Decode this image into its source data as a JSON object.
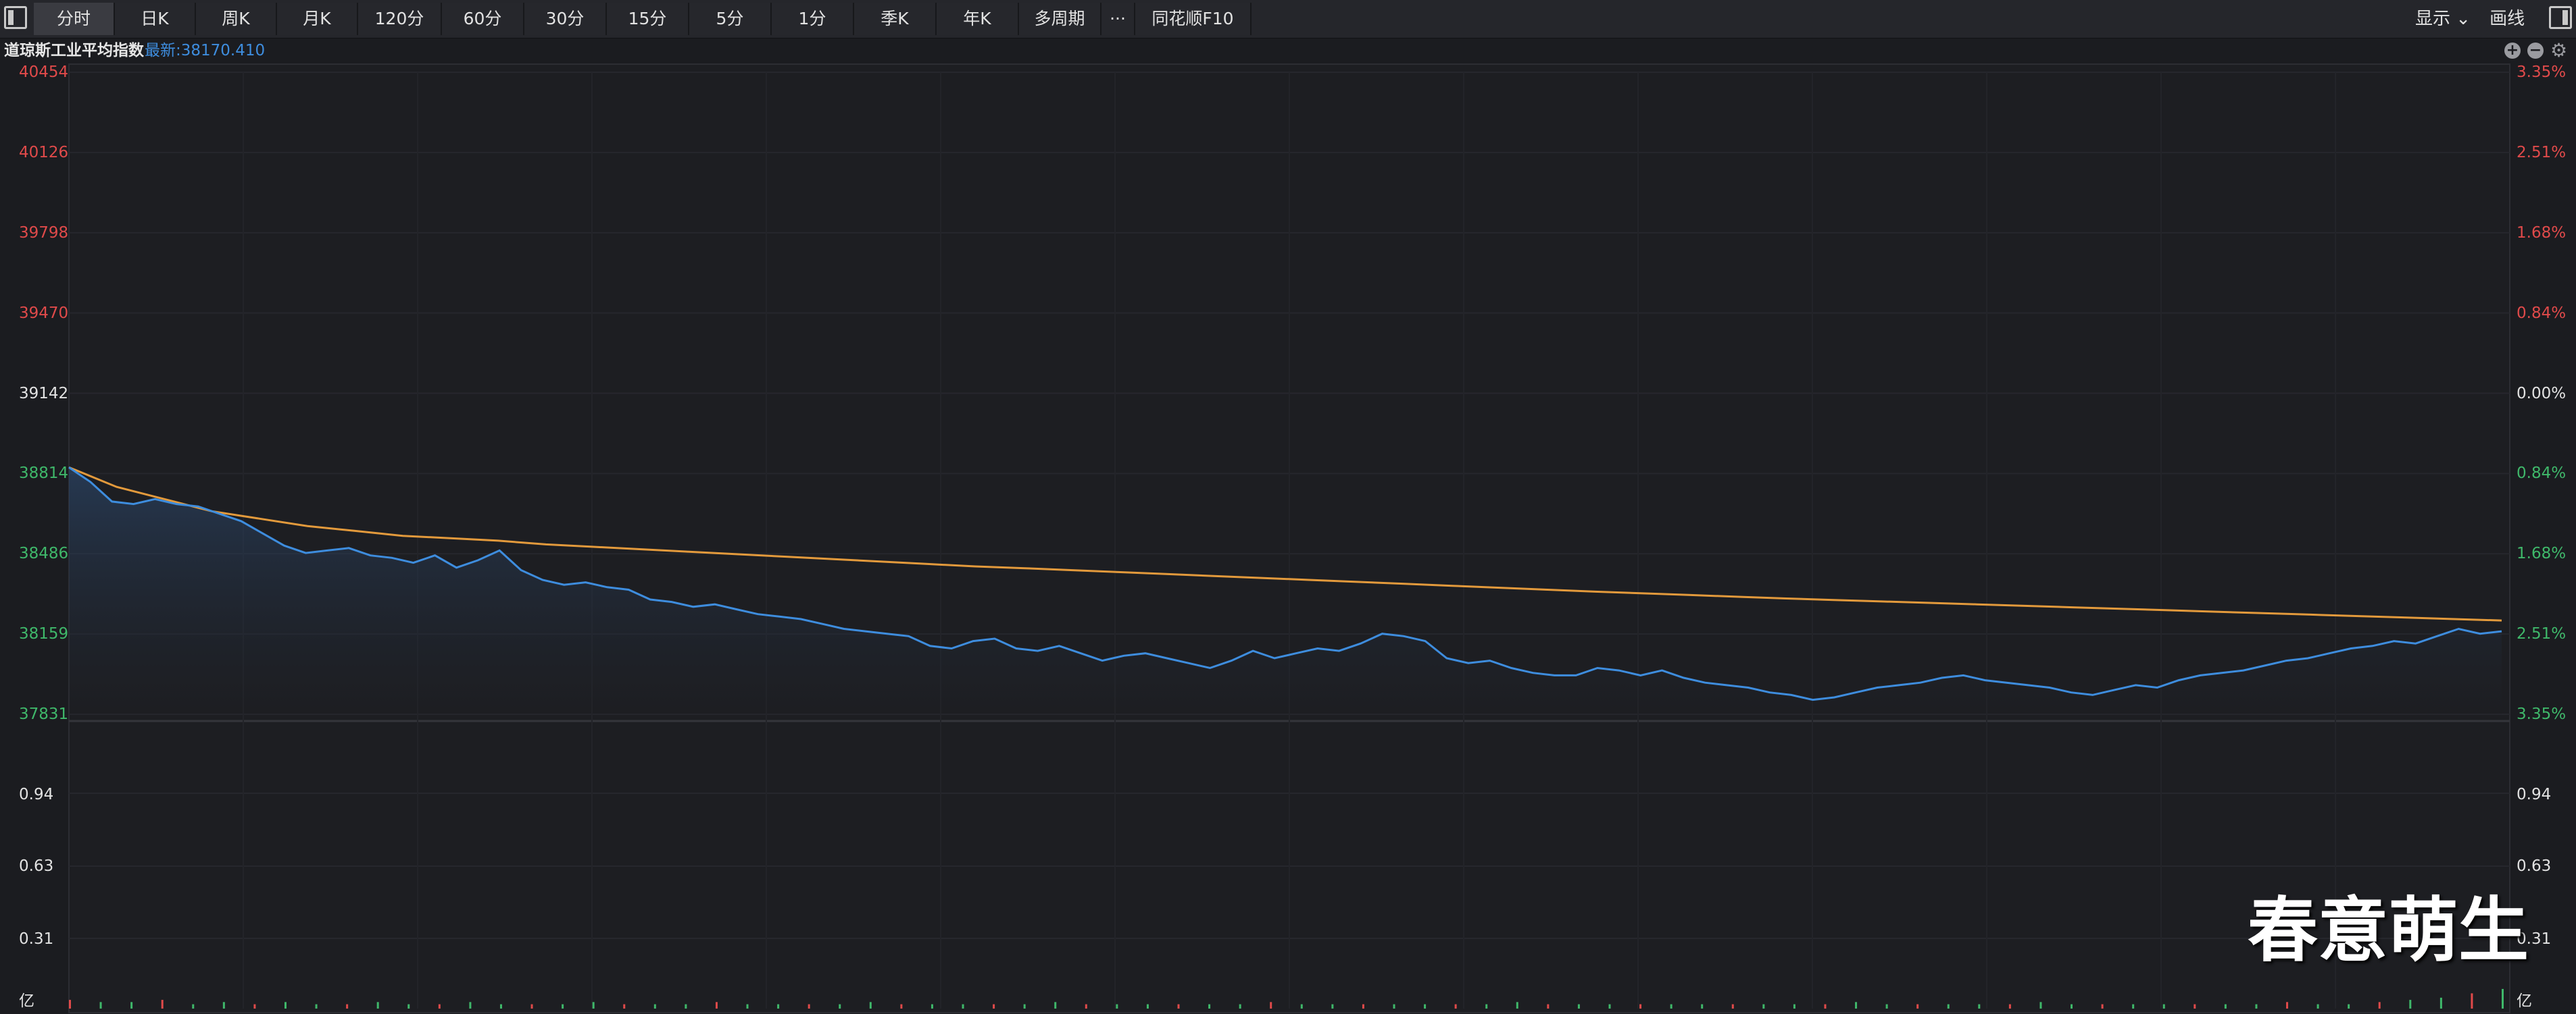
{
  "toolbar": {
    "tabs": [
      {
        "label": "分时",
        "active": true
      },
      {
        "label": "日K",
        "active": false
      },
      {
        "label": "周K",
        "active": false
      },
      {
        "label": "月K",
        "active": false
      },
      {
        "label": "120分",
        "active": false
      },
      {
        "label": "60分",
        "active": false
      },
      {
        "label": "30分",
        "active": false
      },
      {
        "label": "15分",
        "active": false
      },
      {
        "label": "5分",
        "active": false
      },
      {
        "label": "1分",
        "active": false
      },
      {
        "label": "季K",
        "active": false
      },
      {
        "label": "年K",
        "active": false
      },
      {
        "label": "多周期",
        "active": false
      },
      {
        "label": "···",
        "active": false
      },
      {
        "label": "同花顺F10",
        "active": false
      }
    ],
    "display_label": "显示",
    "display_chevron": "⌄",
    "draw_label": "画线"
  },
  "info": {
    "title": "道琼斯工业平均指数",
    "latest": "最新:38170.410"
  },
  "colors": {
    "up": "#e04a4a",
    "down": "#3fb86a",
    "neutral": "#e2e2e2",
    "price_line": "#3e8dde",
    "avg_line": "#e39a3c",
    "accent": "#3e8dde"
  },
  "axes": {
    "price_left": [
      "40454",
      "40126",
      "39798",
      "39470",
      "39142",
      "38814",
      "38486",
      "38159",
      "37831"
    ],
    "pct_right": [
      "3.35%",
      "2.51%",
      "1.68%",
      "0.84%",
      "0.00%",
      "0.84%",
      "1.68%",
      "2.51%",
      "3.35%"
    ],
    "price_colors": [
      "up",
      "up",
      "up",
      "up",
      "neutral",
      "down",
      "down",
      "down",
      "down"
    ],
    "volume_left": [
      "0.94",
      "0.63",
      "0.31",
      "亿"
    ],
    "volume_right": [
      "0.94",
      "0.63",
      "0.31",
      "亿"
    ]
  },
  "chart_data": {
    "type": "line",
    "ylim": [
      37831,
      40454
    ],
    "prev_close": 39142,
    "series": [
      {
        "color": "price_line",
        "values": [
          38840,
          38780,
          38700,
          38690,
          38710,
          38690,
          38680,
          38650,
          38620,
          38570,
          38520,
          38490,
          38500,
          38510,
          38480,
          38470,
          38450,
          38480,
          38430,
          38460,
          38500,
          38420,
          38380,
          38360,
          38370,
          38350,
          38340,
          38300,
          38290,
          38270,
          38280,
          38260,
          38240,
          38230,
          38220,
          38200,
          38180,
          38170,
          38160,
          38150,
          38110,
          38100,
          38130,
          38140,
          38100,
          38090,
          38110,
          38080,
          38050,
          38070,
          38080,
          38060,
          38040,
          38020,
          38050,
          38090,
          38060,
          38080,
          38100,
          38090,
          38120,
          38160,
          38150,
          38130,
          38060,
          38040,
          38050,
          38020,
          38000,
          37990,
          37990,
          38020,
          38010,
          37990,
          38010,
          37980,
          37960,
          37950,
          37940,
          37920,
          37910,
          37890,
          37900,
          37920,
          37940,
          37950,
          37960,
          37980,
          37990,
          37970,
          37960,
          37950,
          37940,
          37920,
          37910,
          37930,
          37950,
          37940,
          37970,
          37990,
          38000,
          38010,
          38030,
          38050,
          38060,
          38080,
          38100,
          38110,
          38130,
          38120,
          38150,
          38180,
          38160,
          38170
        ]
      },
      {
        "color": "avg_line",
        "values": [
          38840,
          38760,
          38710,
          38660,
          38630,
          38600,
          38580,
          38560,
          38550,
          38540,
          38525,
          38515,
          38505,
          38495,
          38485,
          38475,
          38465,
          38455,
          38445,
          38435,
          38428,
          38420,
          38412,
          38404,
          38396,
          38388,
          38380,
          38372,
          38364,
          38356,
          38348,
          38340,
          38332,
          38325,
          38318,
          38311,
          38304,
          38298,
          38292,
          38286,
          38280,
          38274,
          38268,
          38262,
          38256,
          38250,
          38244,
          38238,
          38232,
          38226,
          38220,
          38214
        ]
      }
    ],
    "volume": {
      "ylim": [
        0,
        1.25
      ],
      "values": [
        0.04,
        0.03,
        0.03,
        0.04,
        0.02,
        0.03,
        0.02,
        0.03,
        0.02,
        0.02,
        0.03,
        0.02,
        0.02,
        0.03,
        0.02,
        0.02,
        0.02,
        0.03,
        0.02,
        0.02,
        0.02,
        0.03,
        0.02,
        0.02,
        0.02,
        0.02,
        0.03,
        0.02,
        0.02,
        0.02,
        0.02,
        0.02,
        0.03,
        0.02,
        0.02,
        0.02,
        0.02,
        0.02,
        0.02,
        0.03,
        0.02,
        0.02,
        0.02,
        0.02,
        0.02,
        0.02,
        0.02,
        0.03,
        0.02,
        0.02,
        0.02,
        0.02,
        0.02,
        0.02,
        0.02,
        0.02,
        0.02,
        0.02,
        0.03,
        0.02,
        0.02,
        0.02,
        0.02,
        0.02,
        0.03,
        0.02,
        0.02,
        0.02,
        0.02,
        0.02,
        0.02,
        0.02,
        0.03,
        0.02,
        0.02,
        0.03,
        0.04,
        0.05,
        0.07,
        0.09
      ]
    }
  },
  "watermark": "春意萌生"
}
